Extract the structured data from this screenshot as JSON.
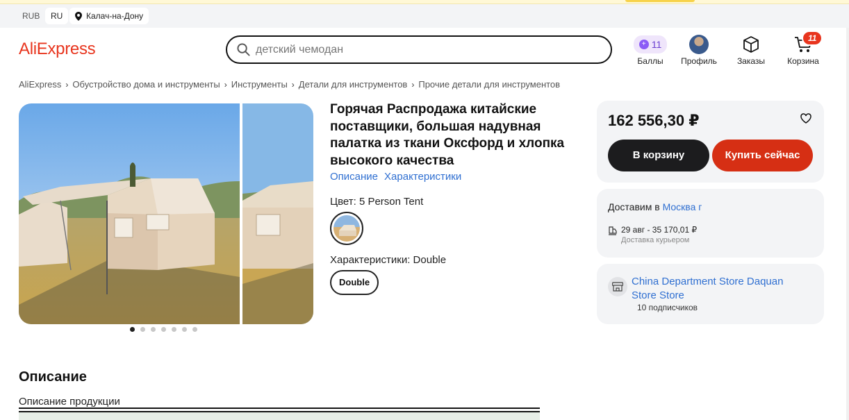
{
  "utility": {
    "currency": "RUB",
    "language": "RU",
    "location": "Калач-на-Дону"
  },
  "header": {
    "logo": "AliExpress",
    "search_placeholder": "детский чемодан",
    "points_count": "11",
    "points_label": "Баллы",
    "profile_label": "Профиль",
    "orders_label": "Заказы",
    "cart_label": "Корзина",
    "cart_count": "11"
  },
  "breadcrumbs": [
    "AliExpress",
    "Обустройство дома и инструменты",
    "Инструменты",
    "Детали для инструментов",
    "Прочие детали для инструментов"
  ],
  "gallery": {
    "dot_count": 7,
    "active_dot": 0
  },
  "product": {
    "title": "Горячая Распродажа китайские поставщики, большая надувная палатка из ткани Оксфорд и хлопка высокого качества",
    "tab_description": "Описание",
    "tab_specs": "Характеристики",
    "color_label": "Цвет: 5 Person Tent",
    "spec_label": "Характеристики: Double",
    "spec_chip": "Double"
  },
  "buy_box": {
    "price": "162 556,30 ₽",
    "add_to_cart": "В корзину",
    "buy_now": "Купить сейчас"
  },
  "delivery": {
    "prefix": "Доставим в",
    "city": "Москва г",
    "date_price": "29 авг - 35 170,01 ₽",
    "method": "Доставка курьером"
  },
  "store": {
    "name": "China Department Store Daquan Store Store",
    "subscribers": "10 подписчиков"
  },
  "description": {
    "title": "Описание",
    "subtitle": "Описание продукции"
  },
  "colors": {
    "brand": "#e8351e",
    "link": "#2f6fd1",
    "buy_now": "#d62f14",
    "add_to_cart": "#1c1c1e"
  }
}
